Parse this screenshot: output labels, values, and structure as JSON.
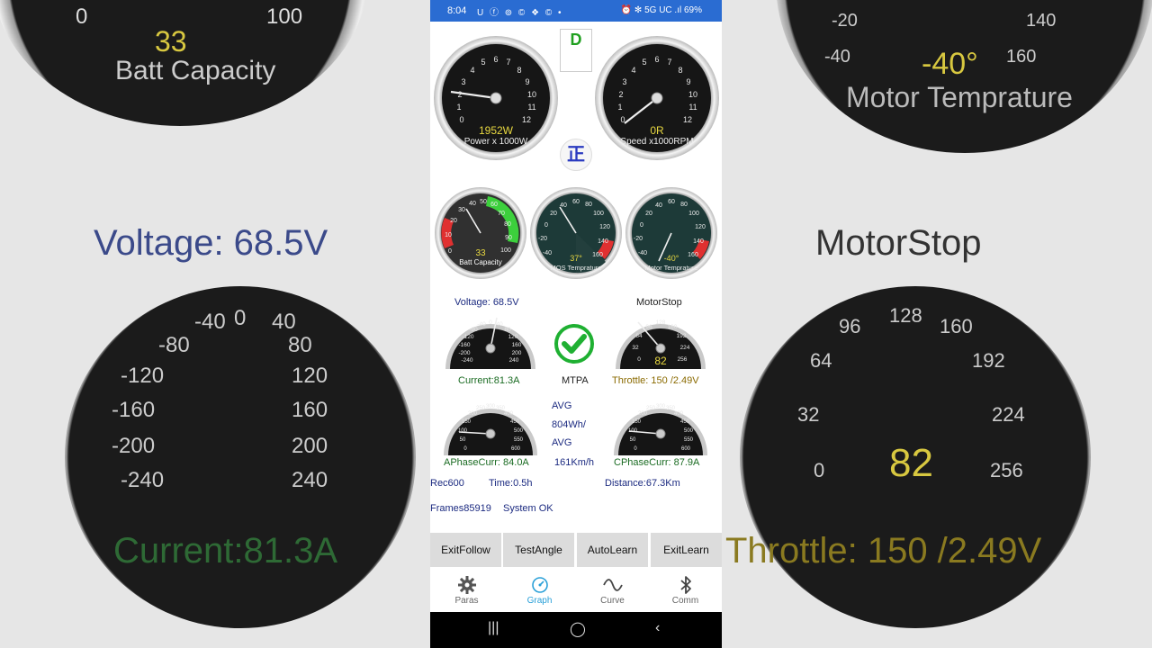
{
  "status_bar": {
    "time": "8:04",
    "icons": "U ⓕ ⊚ © ❖ © •",
    "right": "⏰ ✻ 5G UC .ıl 69%"
  },
  "dashboard": {
    "gear": "D",
    "direction": "正",
    "power": {
      "scale": [
        "0",
        "1",
        "2",
        "3",
        "4",
        "5",
        "6",
        "7",
        "8",
        "9",
        "10",
        "11",
        "12"
      ],
      "value": "1952W",
      "label": "Power x 1000W"
    },
    "speed": {
      "scale": [
        "0",
        "1",
        "2",
        "3",
        "4",
        "5",
        "6",
        "7",
        "8",
        "9",
        "10",
        "11",
        "12"
      ],
      "value": "0R",
      "label": "Speed x1000RPM"
    },
    "batt": {
      "scale": [
        "0",
        "10",
        "20",
        "30",
        "40",
        "50",
        "60",
        "70",
        "80",
        "90",
        "100"
      ],
      "value": "33",
      "label": "Batt Capacity"
    },
    "mos_temp": {
      "scale": [
        "-40",
        "-20",
        "0",
        "20",
        "40",
        "60",
        "80",
        "100",
        "120",
        "140",
        "160"
      ],
      "value": "37°",
      "label": "MOS Temprature"
    },
    "motor_temp": {
      "scale": [
        "-40",
        "-20",
        "0",
        "20",
        "40",
        "60",
        "80",
        "100",
        "120",
        "140",
        "160"
      ],
      "value": "-40°",
      "label": "Motor Temprature"
    },
    "voltage": "Voltage: 68.5V",
    "motor_state": "MotorStop",
    "current_scale": [
      "-240",
      "-200",
      "-160",
      "-120",
      "-80",
      "-40",
      "0",
      "40",
      "80",
      "120",
      "160",
      "200",
      "240"
    ],
    "current": "Current:81.3A",
    "mode": "MTPA",
    "throttle_scale": [
      "0",
      "32",
      "64",
      "96",
      "128",
      "160",
      "192",
      "224",
      "256"
    ],
    "throttle_value": "82",
    "throttle": "Throttle: 150 /2.49V",
    "phase_scale": [
      "0",
      "50",
      "100",
      "150",
      "200",
      "250",
      "300",
      "350",
      "400",
      "450",
      "500",
      "550",
      "600"
    ],
    "avg1": "AVG",
    "avg1_value": "804Wh/",
    "avg2": "AVG",
    "aphase": "APhaseCurr: 84.0A",
    "speed_kmh": "161Km/h",
    "cphase": "CPhaseCurr: 87.9A",
    "rec": "Rec600",
    "time": "Time:0.5h",
    "distance": "Distance:67.3Km",
    "frames": "Frames85919",
    "system": "System OK"
  },
  "buttons": [
    "ExitFollow",
    "TestAngle",
    "AutoLearn",
    "ExitLearn"
  ],
  "nav": [
    {
      "label": "Paras",
      "icon": "gear-icon"
    },
    {
      "label": "Graph",
      "icon": "gauge-icon",
      "active": true
    },
    {
      "label": "Curve",
      "icon": "wave-icon"
    },
    {
      "label": "Comm",
      "icon": "bluetooth-icon"
    }
  ],
  "background": {
    "left_top_zero": "0",
    "left_top_hundred": "100",
    "left_batt_value": "33",
    "left_batt_label": "Batt Capacity",
    "left_voltage": "Voltage: 68.5V",
    "left_current": "Current:81.3A",
    "left_current_scale": [
      "-40",
      "0",
      "40",
      "-80",
      "80",
      "-120",
      "120",
      "-160",
      "160",
      "-200",
      "200",
      "-240",
      "240"
    ],
    "right_motor_temp_value": "-40°",
    "right_motor_temp_label": "Motor Temprature",
    "right_temp_scale": [
      "-20",
      "140",
      "-40",
      "160"
    ],
    "right_motor_state": "MotorStop",
    "right_throttle_scale": [
      "96",
      "128",
      "160",
      "64",
      "192",
      "32",
      "224",
      "0",
      "256"
    ],
    "right_throttle_value": "82",
    "right_throttle": "Throttle: 150 /2.49V"
  },
  "colors": {
    "status_bar": "#2a6cd2",
    "active_nav": "#2aa0d8",
    "digital_yellow": "#e8d840"
  }
}
